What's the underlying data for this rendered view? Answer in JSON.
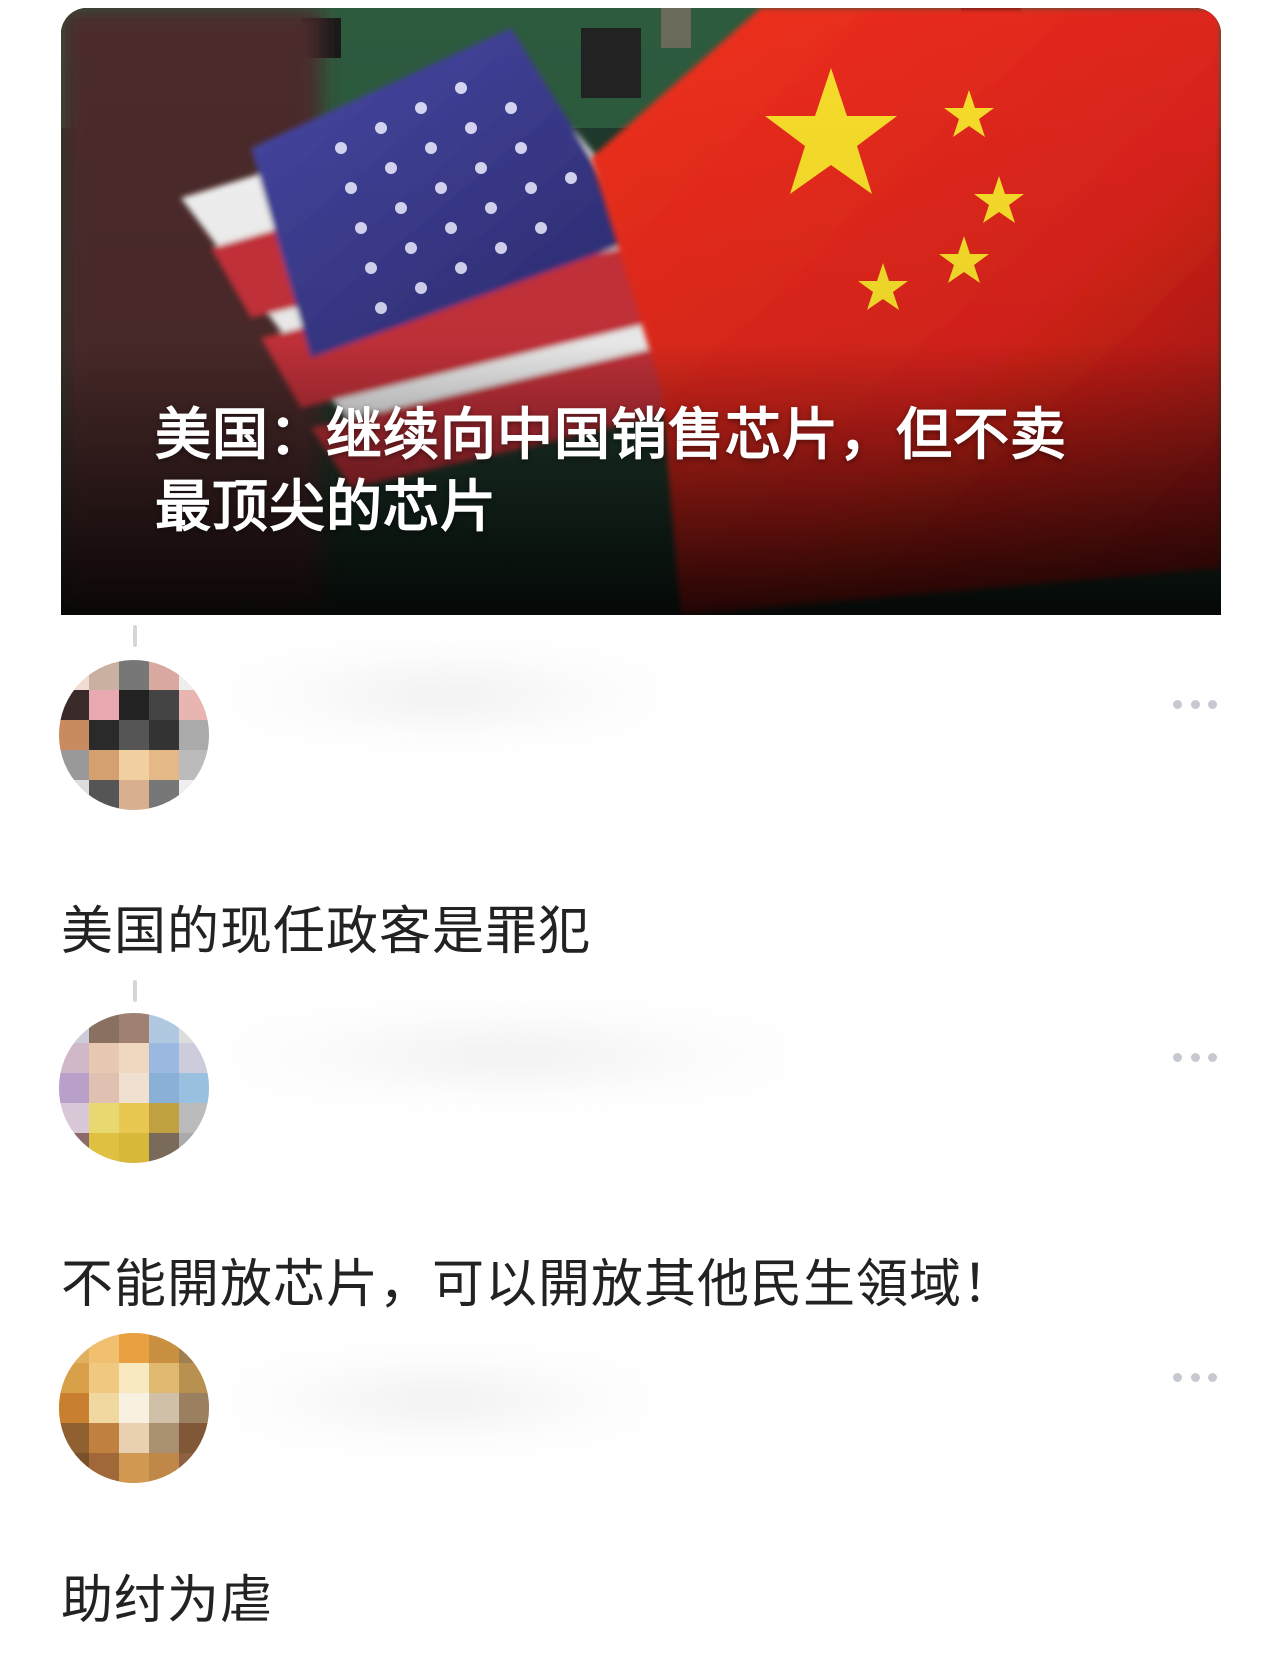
{
  "news": {
    "title": "美国：继续向中国销售芯片，但不卖最顶尖的芯片"
  },
  "comments": [
    {
      "text": "美国的现任政客是罪犯",
      "more_icon": "ellipsis-icon"
    },
    {
      "text": "不能開放芯片，可以開放其他民生領域！",
      "more_icon": "ellipsis-icon"
    },
    {
      "text": "助纣为虐",
      "more_icon": "ellipsis-icon"
    }
  ],
  "colors": {
    "flag_red": "#e3271c",
    "flag_star": "#f7dd2a",
    "flag_blue": "#3c3b8e",
    "text": "#222222",
    "more_dots": "#c6c9d0"
  }
}
